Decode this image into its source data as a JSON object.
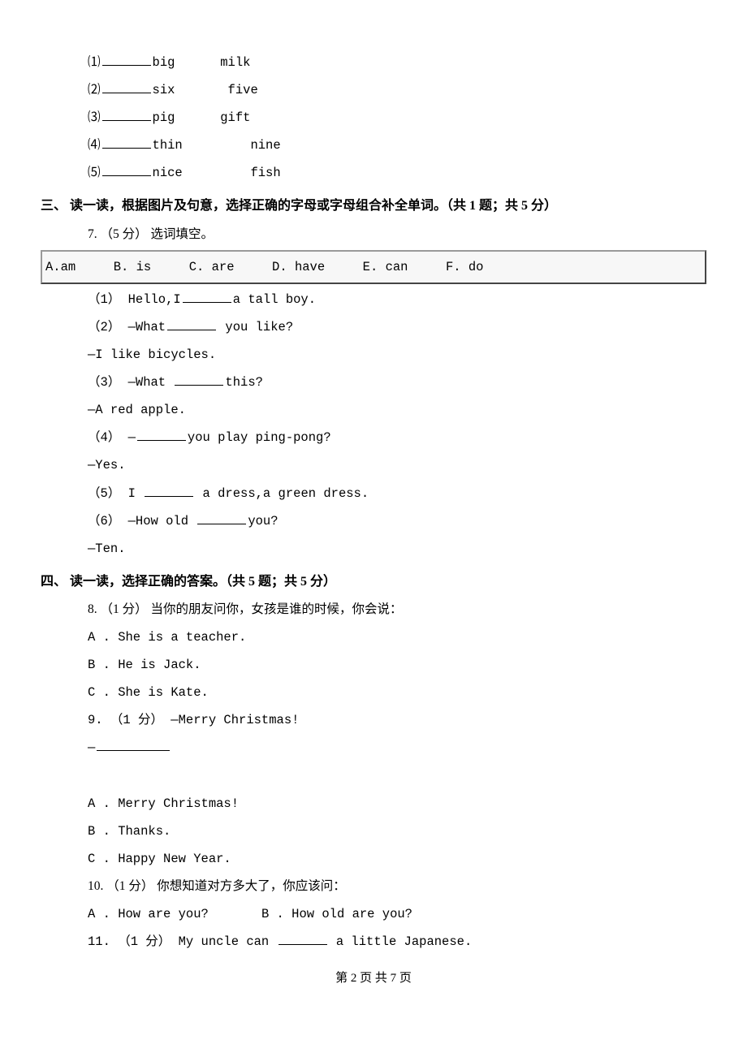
{
  "top_items": [
    {
      "n": "⑴",
      "w1": "big",
      "w2": "milk"
    },
    {
      "n": "⑵",
      "w1": "six",
      "w2": "five"
    },
    {
      "n": "⑶",
      "w1": "pig",
      "w2": "gift"
    },
    {
      "n": "⑷",
      "w1": "thin",
      "w2": "nine"
    },
    {
      "n": "⑸",
      "w1": "nice",
      "w2": "fish"
    }
  ],
  "section3": {
    "heading": "三、 读一读，根据图片及句意，选择正确的字母或字母组合补全单词。（共 1 题；共 5 分）",
    "q7_intro": "7. （5 分） 选词填空。",
    "options": "A.am     B. is     C. are     D. have     E. can     F. do",
    "subs": [
      {
        "pre": "（1） Hello,I",
        "post": "a tall boy."
      },
      {
        "pre": "（2） —What",
        "post": "  you like?"
      }
    ],
    "line_2b": "—I like bicycles.",
    "sub3_pre": "（3） —What ",
    "sub3_post": "this?",
    "line_3b": "—A red apple.",
    "sub4_pre": "（4） —",
    "sub4_post": "you play ping-pong?",
    "line_4b": "—Yes.",
    "sub5_pre": "（5） I ",
    "sub5_post": "    a dress,a green dress.",
    "sub6_pre": "（6） —How old ",
    "sub6_post": "you?",
    "line_6b": "—Ten."
  },
  "section4": {
    "heading": "四、 读一读，选择正确的答案。（共 5 题；共 5 分）",
    "q8": {
      "stem": "8. （1 分） 当你的朋友问你，女孩是谁的时候，你会说：",
      "a": "A . She is a teacher.",
      "b": "B . He is Jack.",
      "c": "C . She is Kate."
    },
    "q9": {
      "stem": "9. （1 分） —Merry Christmas!",
      "reply": "—",
      "a": "A . Merry Christmas!",
      "b": "B . Thanks.",
      "c": "C . Happy New Year."
    },
    "q10": {
      "stem": "10. （1 分） 你想知道对方多大了，你应该问：",
      "a": "A . How are you?",
      "b": "B . How old are you?"
    },
    "q11": {
      "pre": "11. （1 分） My uncle can ",
      "post": " a little Japanese."
    }
  },
  "footer": "第 2 页 共 7 页"
}
